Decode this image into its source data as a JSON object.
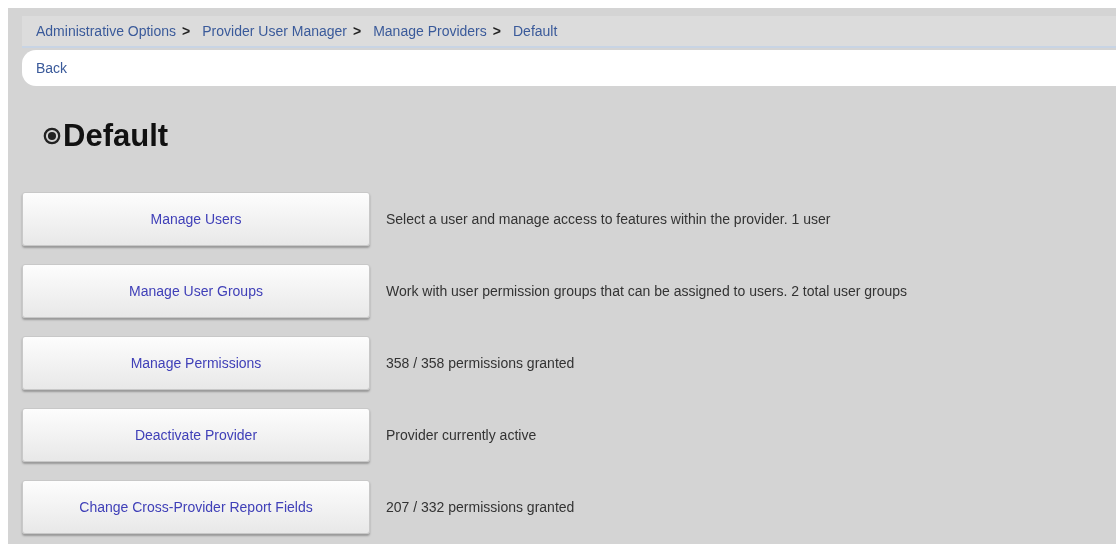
{
  "breadcrumb": [
    {
      "label": "Administrative Options",
      "separator": ">"
    },
    {
      "label": "Provider User Manager",
      "separator": ">"
    },
    {
      "label": "Manage Providers",
      "separator": ">"
    },
    {
      "label": "Default"
    }
  ],
  "back_link": "Back",
  "title": "Default",
  "actions": [
    {
      "button": "Manage Users",
      "description": "Select a user and manage access to features within the provider. 1 user"
    },
    {
      "button": "Manage User Groups",
      "description": "Work with user permission groups that can be assigned to users. 2 total user groups"
    },
    {
      "button": "Manage Permissions",
      "description": "358 / 358 permissions granted"
    },
    {
      "button": "Deactivate Provider",
      "description": "Provider currently active"
    },
    {
      "button": "Change Cross-Provider Report Fields",
      "description": "207 / 332 permissions granted"
    }
  ]
}
